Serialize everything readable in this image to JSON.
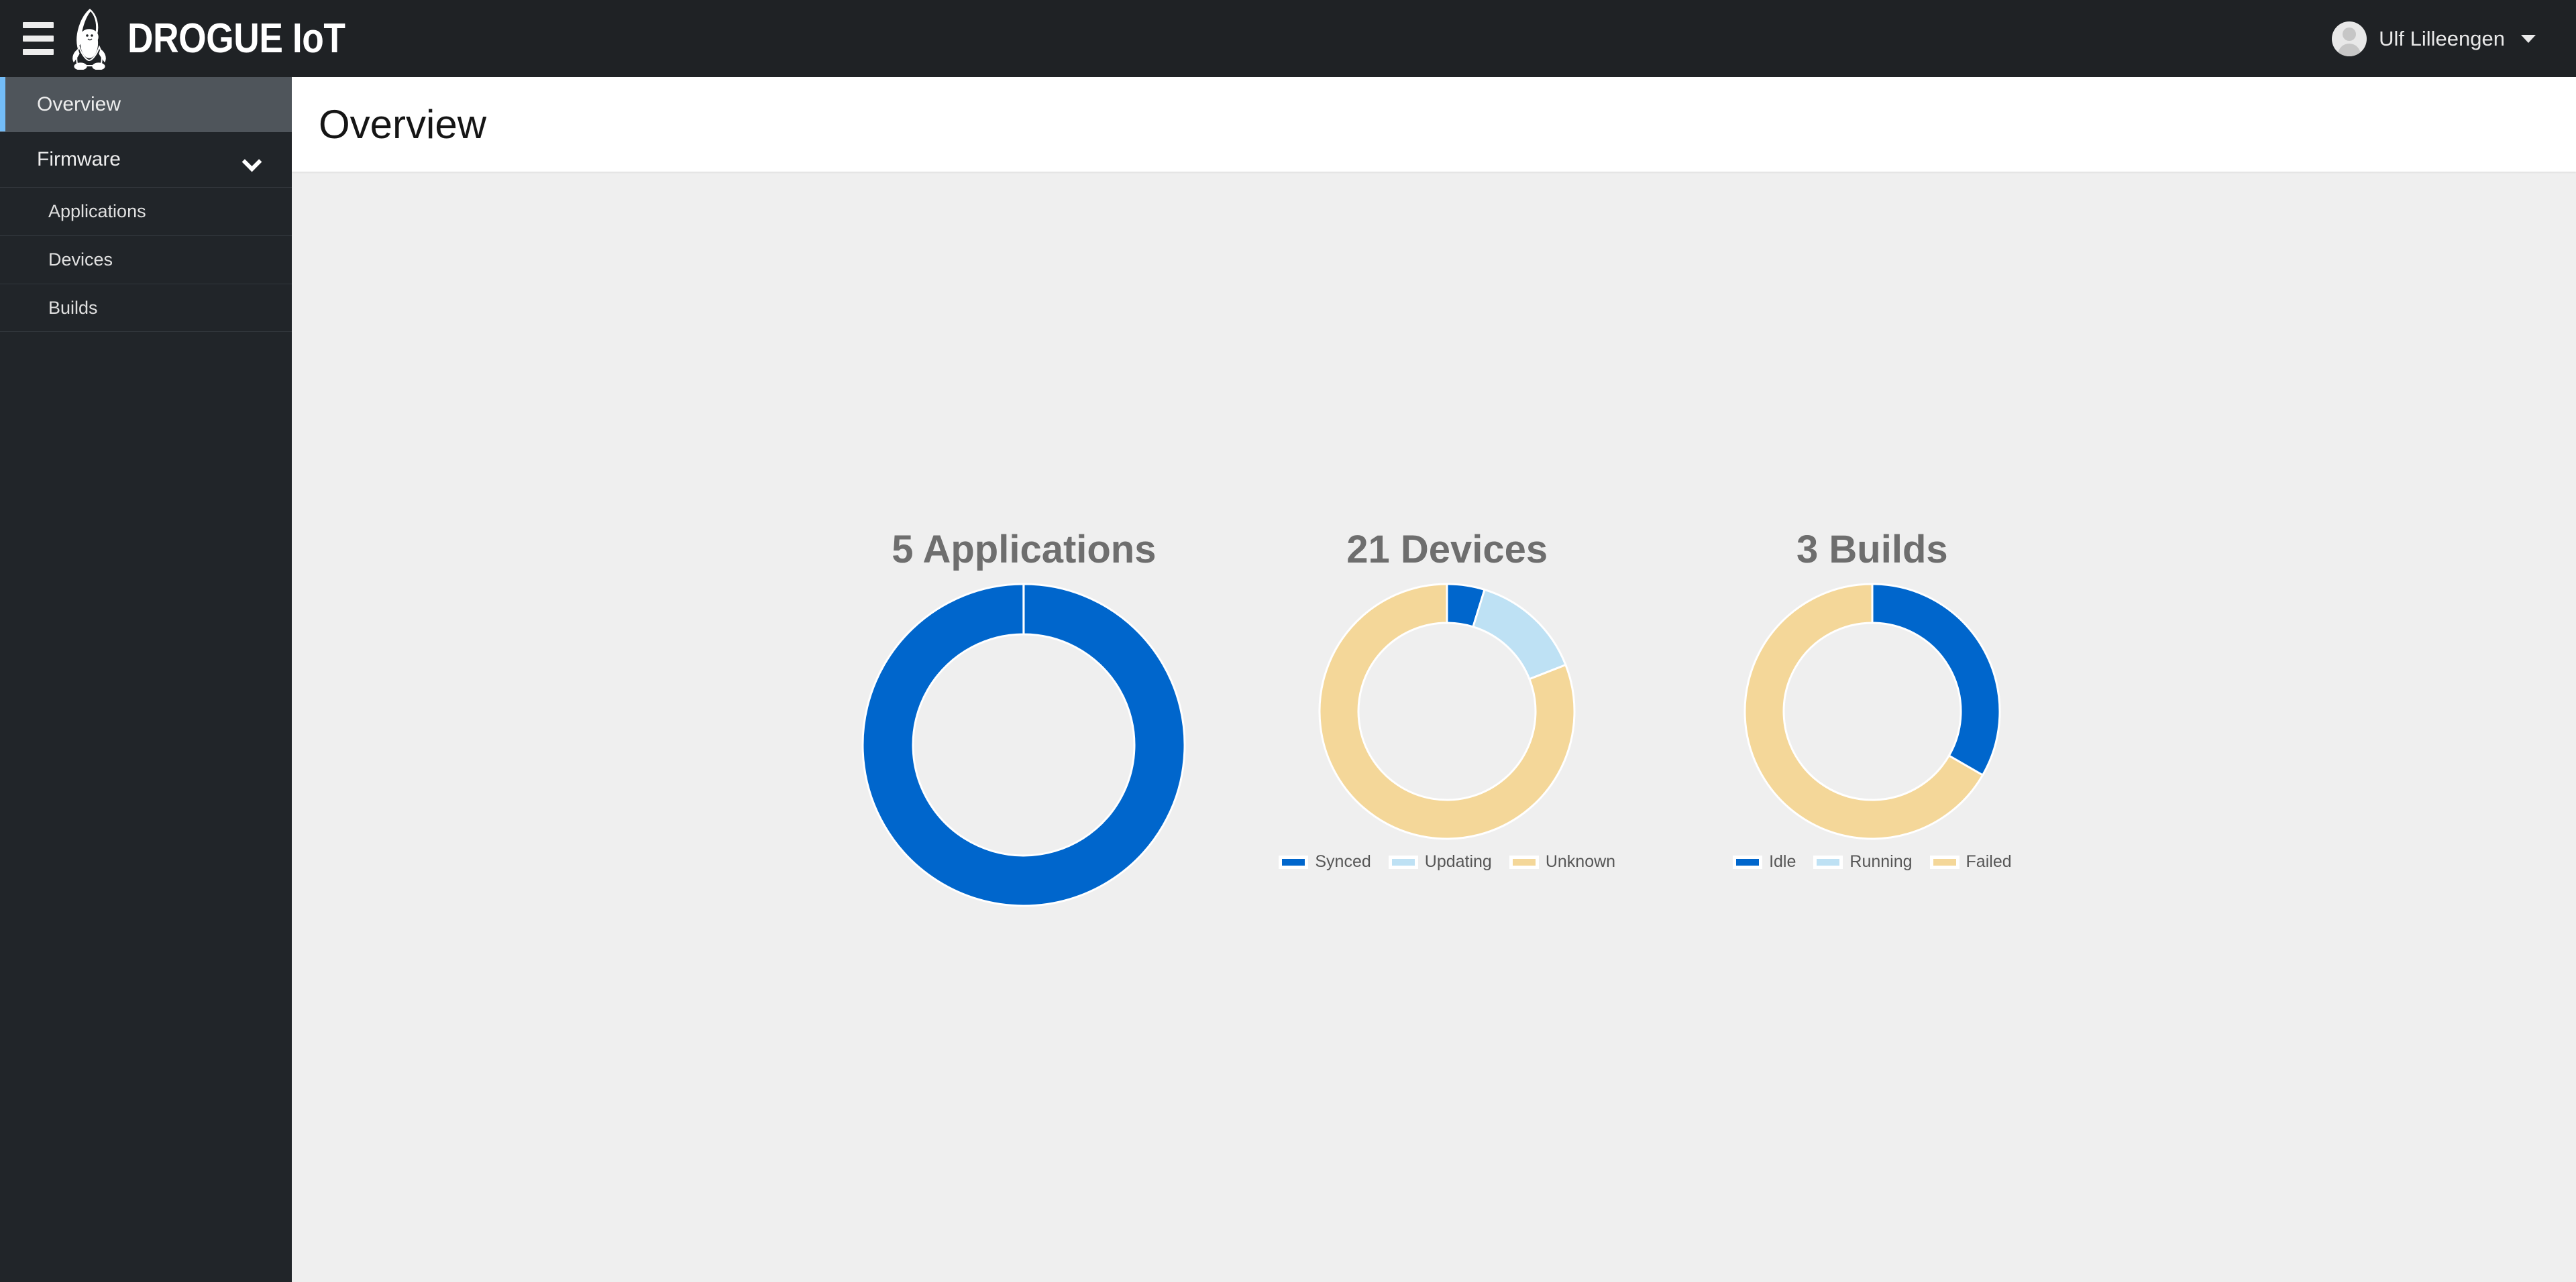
{
  "masthead": {
    "hamburger_icon": "hamburger-menu-icon",
    "brand_logo_icon": "drogue-gnome-logo",
    "brand_text": "DROGUE IoT",
    "user": {
      "name": "Ulf Lilleengen",
      "avatar_icon": "user-avatar-icon",
      "caret_icon": "caret-down-icon"
    }
  },
  "sidebar": {
    "items": [
      {
        "label": "Overview",
        "active": true,
        "type": "item"
      },
      {
        "label": "Firmware",
        "active": false,
        "type": "group",
        "expanded": true,
        "chevron_icon": "chevron-down-icon"
      },
      {
        "label": "Applications",
        "active": false,
        "type": "sub"
      },
      {
        "label": "Devices",
        "active": false,
        "type": "sub"
      },
      {
        "label": "Builds",
        "active": false,
        "type": "sub"
      }
    ]
  },
  "page": {
    "title": "Overview"
  },
  "colors": {
    "blue": "#0066CC",
    "light_blue": "#BEE1F4",
    "tan": "#F4D799",
    "gray_text": "#6E6E6E",
    "accent_active": "#73BCF7",
    "masthead_bg": "#1F2225",
    "sidebar_bg": "#212529",
    "content_bg": "#EFEFEF"
  },
  "chart_data": [
    {
      "type": "pie",
      "variant": "donut",
      "title": "5 Applications",
      "categories": [
        "Applications"
      ],
      "values": [
        5
      ],
      "total": 5,
      "colors": [
        "#0066CC"
      ],
      "legend": null,
      "legend_position": "none",
      "start_angle": 0,
      "outer_radius": 240,
      "inner_radius": 165
    },
    {
      "type": "pie",
      "variant": "donut",
      "title": "21 Devices",
      "categories": [
        "Synced",
        "Updating",
        "Unknown"
      ],
      "values": [
        1,
        3,
        17
      ],
      "total": 21,
      "colors": [
        "#0066CC",
        "#BEE1F4",
        "#F4D799"
      ],
      "legend": [
        "Synced",
        "Updating",
        "Unknown"
      ],
      "legend_position": "bottom",
      "start_angle": 0,
      "outer_radius": 190,
      "inner_radius": 132
    },
    {
      "type": "pie",
      "variant": "donut",
      "title": "3 Builds",
      "categories": [
        "Idle",
        "Running",
        "Failed"
      ],
      "values": [
        1,
        0,
        2
      ],
      "total": 3,
      "colors": [
        "#0066CC",
        "#BEE1F4",
        "#F4D799"
      ],
      "legend": [
        "Idle",
        "Running",
        "Failed"
      ],
      "legend_position": "bottom",
      "start_angle": 0,
      "outer_radius": 190,
      "inner_radius": 132
    }
  ]
}
